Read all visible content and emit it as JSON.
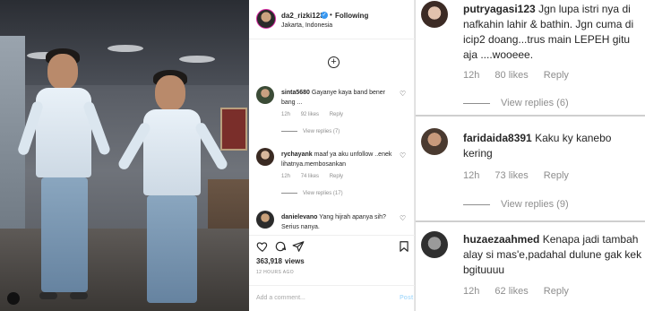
{
  "post": {
    "username": "da2_rizki123",
    "follow_label": "Following",
    "location": "Jakarta, Indonesia",
    "load_more_symbol": "+",
    "comments": [
      {
        "username": "sinta5680",
        "text": "Gayanye kaya band bener bang ...",
        "age": "12h",
        "likes": "92 likes",
        "reply": "Reply",
        "view_replies": "View replies (7)"
      },
      {
        "username": "rychayank",
        "text": "maaf ya aku unfollow ..enek lihatnya.membosankan",
        "age": "12h",
        "likes": "74 likes",
        "reply": "Reply",
        "view_replies": "View replies (17)"
      },
      {
        "username": "danielevano",
        "text": "Yang hijrah apanya sih? Serius nanya."
      }
    ],
    "views_count": "363,918",
    "views_label": "views",
    "time_ago": "12 HOURS AGO",
    "add_comment_placeholder": "Add a comment...",
    "post_button": "Post"
  },
  "zoom": {
    "comments": [
      {
        "username": "putryagasi123",
        "text": "Jgn lupa istri nya di nafkahin lahir & bathin. Jgn cuma di icip2 doang...trus main LEPEH gitu aja ....wooeee.",
        "age": "12h",
        "likes": "80 likes",
        "reply": "Reply",
        "view_replies": "View replies (6)"
      },
      {
        "username": "faridaida8391",
        "text": "Kaku ky kanebo kering",
        "age": "12h",
        "likes": "73 likes",
        "reply": "Reply",
        "view_replies": "View replies (9)"
      },
      {
        "username": "huzaezaahmed",
        "text": "Kenapa jadi tambah alay si mas'e,padahal dulune gak kek bgituuuu",
        "age": "12h",
        "likes": "62 likes",
        "reply": "Reply"
      }
    ]
  },
  "icons": [
    "heart-icon",
    "comment-icon",
    "share-icon",
    "bookmark-icon",
    "plus-circle-icon",
    "verified-icon",
    "tiktok-icon"
  ],
  "colors": {
    "verified": "#3897f0",
    "muted": "#8e8e8e",
    "text": "#262626",
    "post_button": "#b2dffc"
  }
}
